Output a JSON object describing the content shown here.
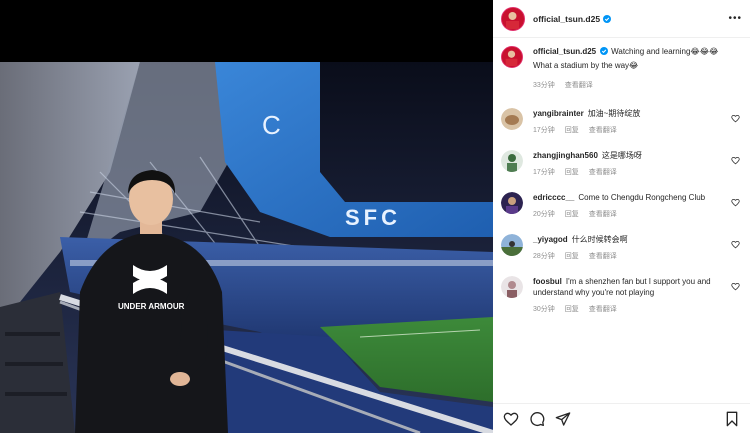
{
  "post": {
    "author": "official_tsun.d25",
    "more_glyph": "•••",
    "caption": {
      "author": "official_tsun.d25",
      "text": "Watching and learning😂😂😂",
      "text2": "What a stadium by the way😂",
      "time": "33分钟",
      "translate": "查看翻译"
    }
  },
  "comments": [
    {
      "user": "yangibrainter",
      "text": "加油~期待绽放",
      "time": "17分钟",
      "reply": "回复",
      "translate": "查看翻译"
    },
    {
      "user": "zhangjinghan560",
      "text": "这是哪场呀",
      "time": "17分钟",
      "reply": "回复",
      "translate": "查看翻译"
    },
    {
      "user": "edricccc__",
      "text": "Come to Chengdu Rongcheng Club",
      "time": "20分钟",
      "reply": "回复",
      "translate": "查看翻译"
    },
    {
      "user": "_yiyagod",
      "text": "什么时候转会啊",
      "time": "28分钟",
      "reply": "回复",
      "translate": "查看翻译"
    },
    {
      "user": "foosbul",
      "text": "I'm a shenzhen fan but I support you and understand why you're not playing",
      "time": "30分钟",
      "reply": "回复",
      "translate": "查看翻译"
    }
  ],
  "photo": {
    "stadium_sign": "SFC",
    "shirt_brand": "UNDER ARMOUR"
  },
  "colors": {
    "accent_ring": "#e1306c",
    "verified_blue": "#0095f6",
    "meta_gray": "#8e8e8e"
  },
  "icons": [
    "heart-icon",
    "comment-icon",
    "share-icon",
    "bookmark-icon",
    "verified-icon",
    "more-icon"
  ]
}
